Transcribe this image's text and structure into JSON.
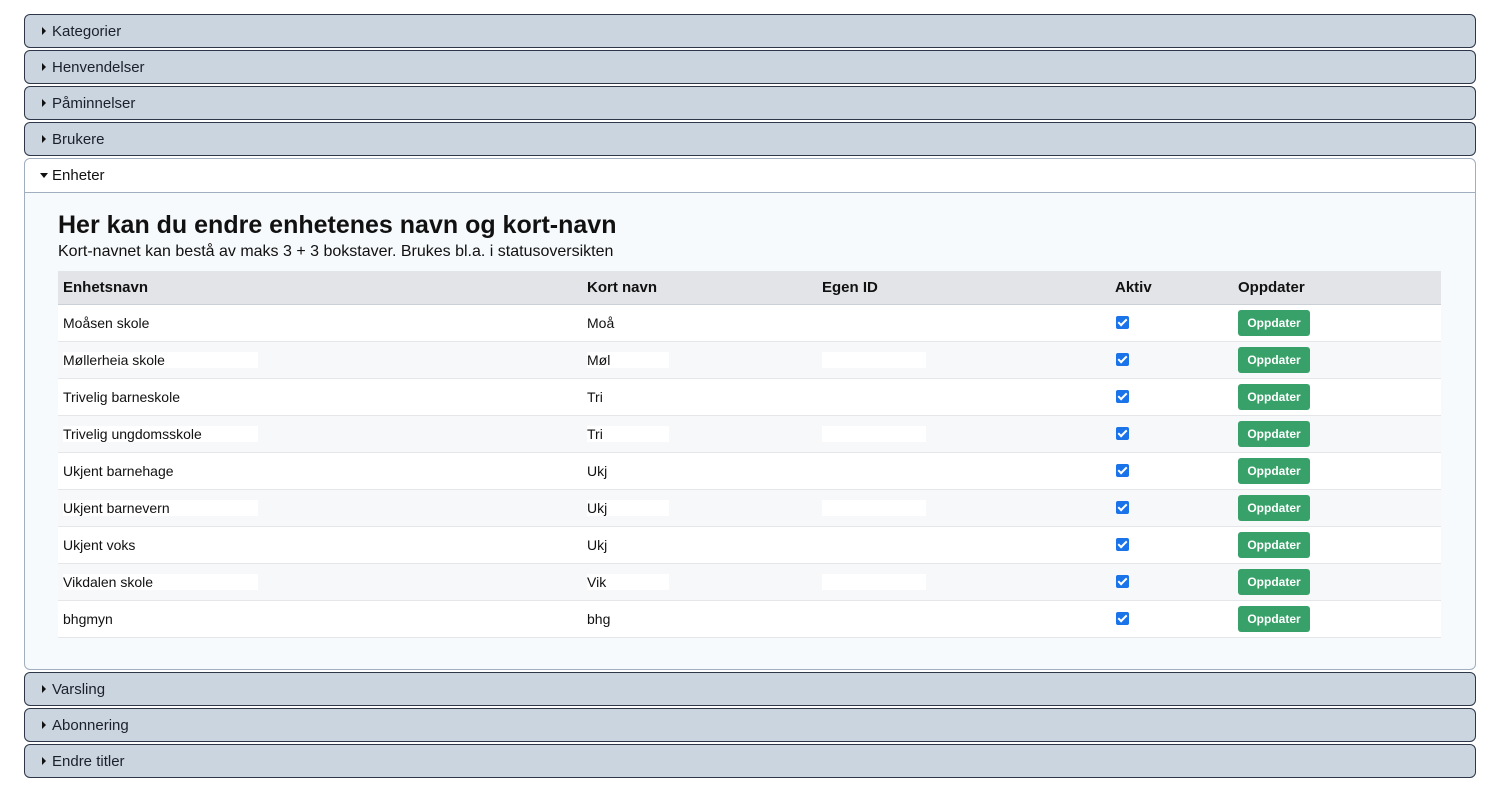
{
  "sections_before": [
    "Kategorier",
    "Henvendelser",
    "Påminnelser",
    "Brukere"
  ],
  "open_section": {
    "title": "Enheter",
    "heading": "Her kan du endre enhetenes navn og kort-navn",
    "subtext": "Kort-navnet kan bestå av maks 3 + 3 bokstaver. Brukes bl.a. i statusoversikten",
    "columns": [
      "Enhetsnavn",
      "Kort navn",
      "Egen ID",
      "Aktiv",
      "Oppdater"
    ],
    "rows": [
      {
        "name": "Moåsen skole",
        "short": "Moå",
        "egen_id": "",
        "active": true,
        "button": "Oppdater"
      },
      {
        "name": "Møllerheia skole",
        "short": "Møl",
        "egen_id": "",
        "active": true,
        "button": "Oppdater"
      },
      {
        "name": "Trivelig barneskole",
        "short": "Tri",
        "egen_id": "",
        "active": true,
        "button": "Oppdater"
      },
      {
        "name": "Trivelig ungdomsskole",
        "short": "Tri",
        "egen_id": "",
        "active": true,
        "button": "Oppdater"
      },
      {
        "name": "Ukjent barnehage",
        "short": "Ukj",
        "egen_id": "",
        "active": true,
        "button": "Oppdater"
      },
      {
        "name": "Ukjent barnevern",
        "short": "Ukj",
        "egen_id": "",
        "active": true,
        "button": "Oppdater"
      },
      {
        "name": "Ukjent voks",
        "short": "Ukj",
        "egen_id": "",
        "active": true,
        "button": "Oppdater"
      },
      {
        "name": "Vikdalen skole",
        "short": "Vik",
        "egen_id": "",
        "active": true,
        "button": "Oppdater"
      },
      {
        "name": "bhgmyn",
        "short": "bhg",
        "egen_id": "",
        "active": true,
        "button": "Oppdater"
      }
    ]
  },
  "sections_after": [
    "Varsling",
    "Abonnering",
    "Endre titler"
  ],
  "colors": {
    "accordion_bg": "#cbd5e0",
    "button_green": "#38a169",
    "checkbox_blue": "#1a73e8"
  }
}
